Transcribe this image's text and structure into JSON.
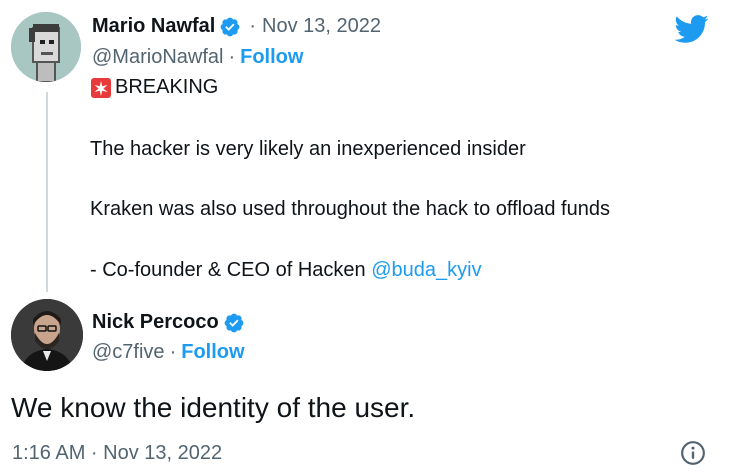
{
  "quoted_tweet": {
    "author_name": "Mario Nawfal",
    "sep_dot": "·",
    "date": "Nov 13, 2022",
    "handle": "@MarioNawfal",
    "follow_label": "Follow",
    "lines": {
      "breaking": "BREAKING",
      "line1": "The hacker is very likely an inexperienced insider",
      "line2": "Kraken was also used throughout the hack to offload funds",
      "line3_prefix": "- Co-founder & CEO of Hacken ",
      "line3_mention": "@buda_kyiv"
    }
  },
  "main_tweet": {
    "author_name": "Nick Percoco",
    "handle": "@c7five",
    "sep_dot": "·",
    "follow_label": "Follow",
    "text": "We know the identity of the user.",
    "timestamp": "1:16 AM · Nov 13, 2022"
  },
  "icons": {
    "twitter": "twitter-bird-icon",
    "verified": "verified-badge-icon",
    "siren": "siren-emoji-icon",
    "info": "info-icon"
  },
  "colors": {
    "link_blue": "#1d9bf0",
    "text": "#0f1419",
    "secondary": "#536471",
    "thread_line": "#cfd9de"
  }
}
